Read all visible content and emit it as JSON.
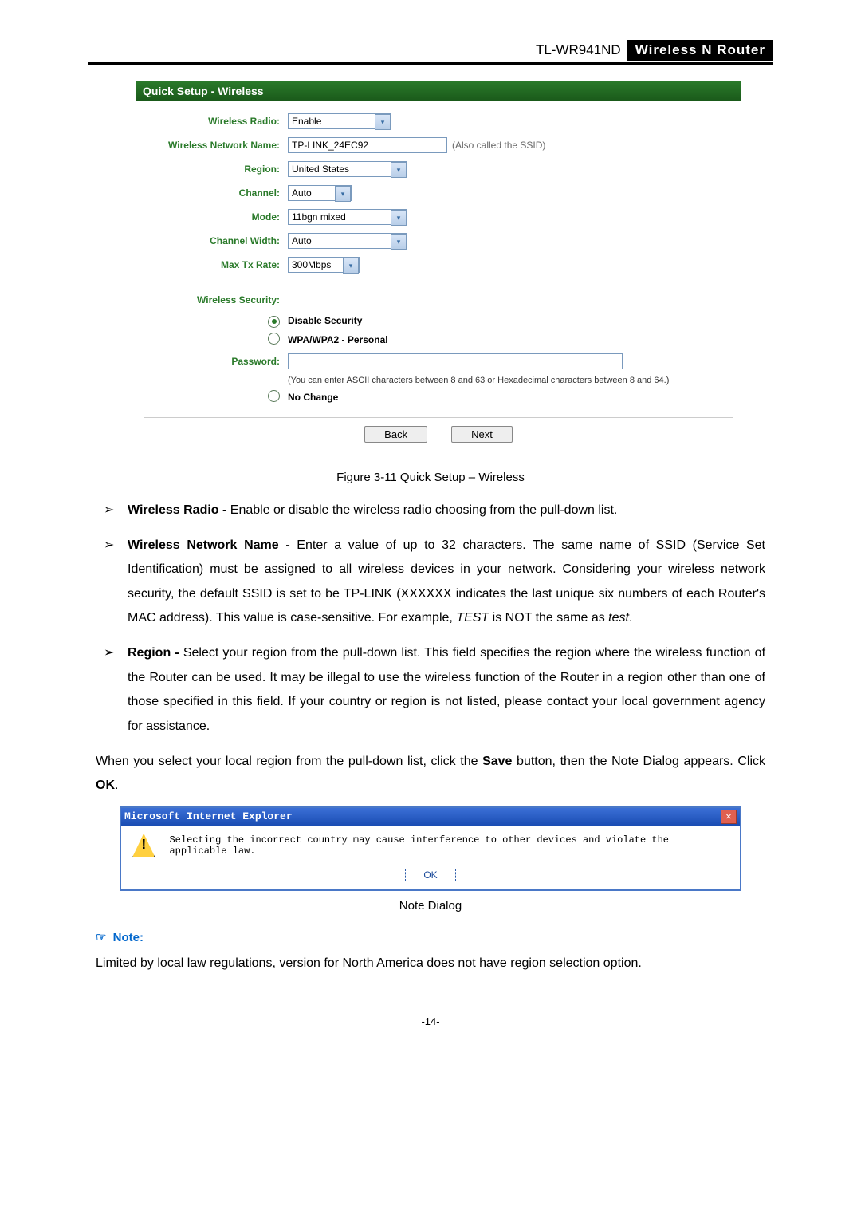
{
  "header": {
    "model": "TL-WR941ND",
    "product": "Wireless  N  Router"
  },
  "panel": {
    "title": "Quick Setup - Wireless",
    "fields": {
      "wireless_radio_label": "Wireless Radio:",
      "wireless_radio_value": "Enable",
      "network_name_label": "Wireless Network Name:",
      "network_name_value": "TP-LINK_24EC92",
      "network_name_hint": "(Also called the SSID)",
      "region_label": "Region:",
      "region_value": "United States",
      "channel_label": "Channel:",
      "channel_value": "Auto",
      "mode_label": "Mode:",
      "mode_value": "11bgn mixed",
      "channel_width_label": "Channel Width:",
      "channel_width_value": "Auto",
      "max_tx_label": "Max Tx Rate:",
      "max_tx_value": "300Mbps",
      "security_label": "Wireless Security:",
      "opt_disable": "Disable Security",
      "opt_wpa": "WPA/WPA2 - Personal",
      "password_label": "Password:",
      "password_hint": "(You can enter ASCII characters between 8 and 63 or Hexadecimal characters between 8 and 64.)",
      "opt_nochange": "No Change",
      "btn_back": "Back",
      "btn_next": "Next"
    }
  },
  "figure_caption": "Figure 3-11    Quick Setup – Wireless",
  "bullets": {
    "b1_lead": "Wireless Radio - ",
    "b1_rest": "Enable or disable the wireless radio choosing from the pull-down list.",
    "b2_lead": "Wireless Network Name - ",
    "b2_rest": "Enter a value of up to 32 characters. The same name of SSID (Service Set Identification) must be assigned to all wireless devices in your network. Considering your wireless network security, the default SSID is set to be TP-LINK (XXXXXX indicates the last unique six numbers of each Router's MAC address). This value is case-sensitive. For example, ",
    "b2_em1": "TEST",
    "b2_mid": " is NOT the same as ",
    "b2_em2": "test",
    "b2_end": ".",
    "b3_lead": "Region - ",
    "b3_rest": "Select your region from the pull-down list. This field specifies the region where the wireless function of the Router can be used. It may be illegal to use the wireless function of the Router in a region other than one of those specified in this field. If your country or region is not listed, please contact your local government agency for assistance."
  },
  "para_after": {
    "p1": "When you select your local region from the pull-down list, click the ",
    "save": "Save",
    "p2": " button, then the Note Dialog appears. Click ",
    "ok": "OK",
    "p3": "."
  },
  "dialog": {
    "title": "Microsoft Internet Explorer",
    "message": "Selecting the incorrect country may cause interference to other devices and violate the applicable law.",
    "ok": "OK",
    "caption": "Note Dialog"
  },
  "note": {
    "heading": "Note:",
    "body": "Limited by local law regulations, version for North America does not have region selection option."
  },
  "page_number": "-14-"
}
